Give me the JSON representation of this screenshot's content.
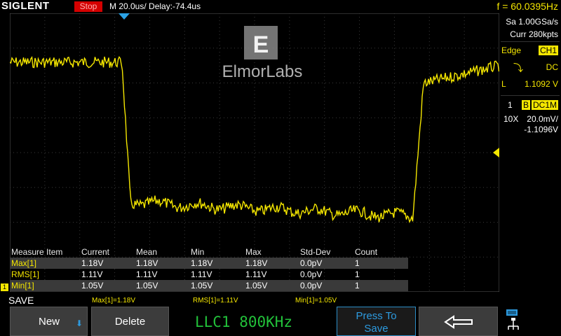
{
  "header": {
    "brand": "SIGLENT",
    "status": "Stop",
    "timebase": "M 20.0us/",
    "delay": "Delay:-74.4us",
    "frequency": "f = 60.0395Hz"
  },
  "watermark": {
    "text": "ElmorLabs"
  },
  "right_panel": {
    "sample_rate": "Sa 1.00GSa/s",
    "memory": "Curr 280kpts",
    "trigger_type": "Edge",
    "trigger_source": "CH1",
    "trigger_coupling": "DC",
    "trigger_level_label": "L",
    "trigger_level": "1.1092 V",
    "channel_number": "1",
    "channel_bw": "B",
    "channel_coupling": "DC1M",
    "probe": "10X",
    "scale": "20.0mV/",
    "offset": "-1.1096V"
  },
  "measurements": {
    "headers": [
      "Measure Item",
      "Current",
      "Mean",
      "Min",
      "Max",
      "Std-Dev",
      "Count"
    ],
    "rows": [
      [
        "Max[1]",
        "1.18V",
        "1.18V",
        "1.18V",
        "1.18V",
        "0.0pV",
        "1"
      ],
      [
        "RMS[1]",
        "1.11V",
        "1.11V",
        "1.11V",
        "1.11V",
        "0.0pV",
        "1"
      ],
      [
        "Min[1]",
        "1.05V",
        "1.05V",
        "1.05V",
        "1.05V",
        "0.0pV",
        "1"
      ]
    ]
  },
  "status_line": {
    "menu_title": "SAVE",
    "stat1": "Max[1]=1.18V",
    "stat2": "RMS[1]=1.11V",
    "stat3": "Min[1]=1.05V"
  },
  "channel_marker": "1",
  "softkeys": {
    "new": "New",
    "delete": "Delete",
    "overlay_text": "LLC1 800KHz",
    "press_line1": "Press To",
    "press_line2": "Save"
  },
  "colors": {
    "trace": "#f4e600",
    "accent": "#2d9be0",
    "stop": "#d40000",
    "overlay": "#22c13a"
  }
}
